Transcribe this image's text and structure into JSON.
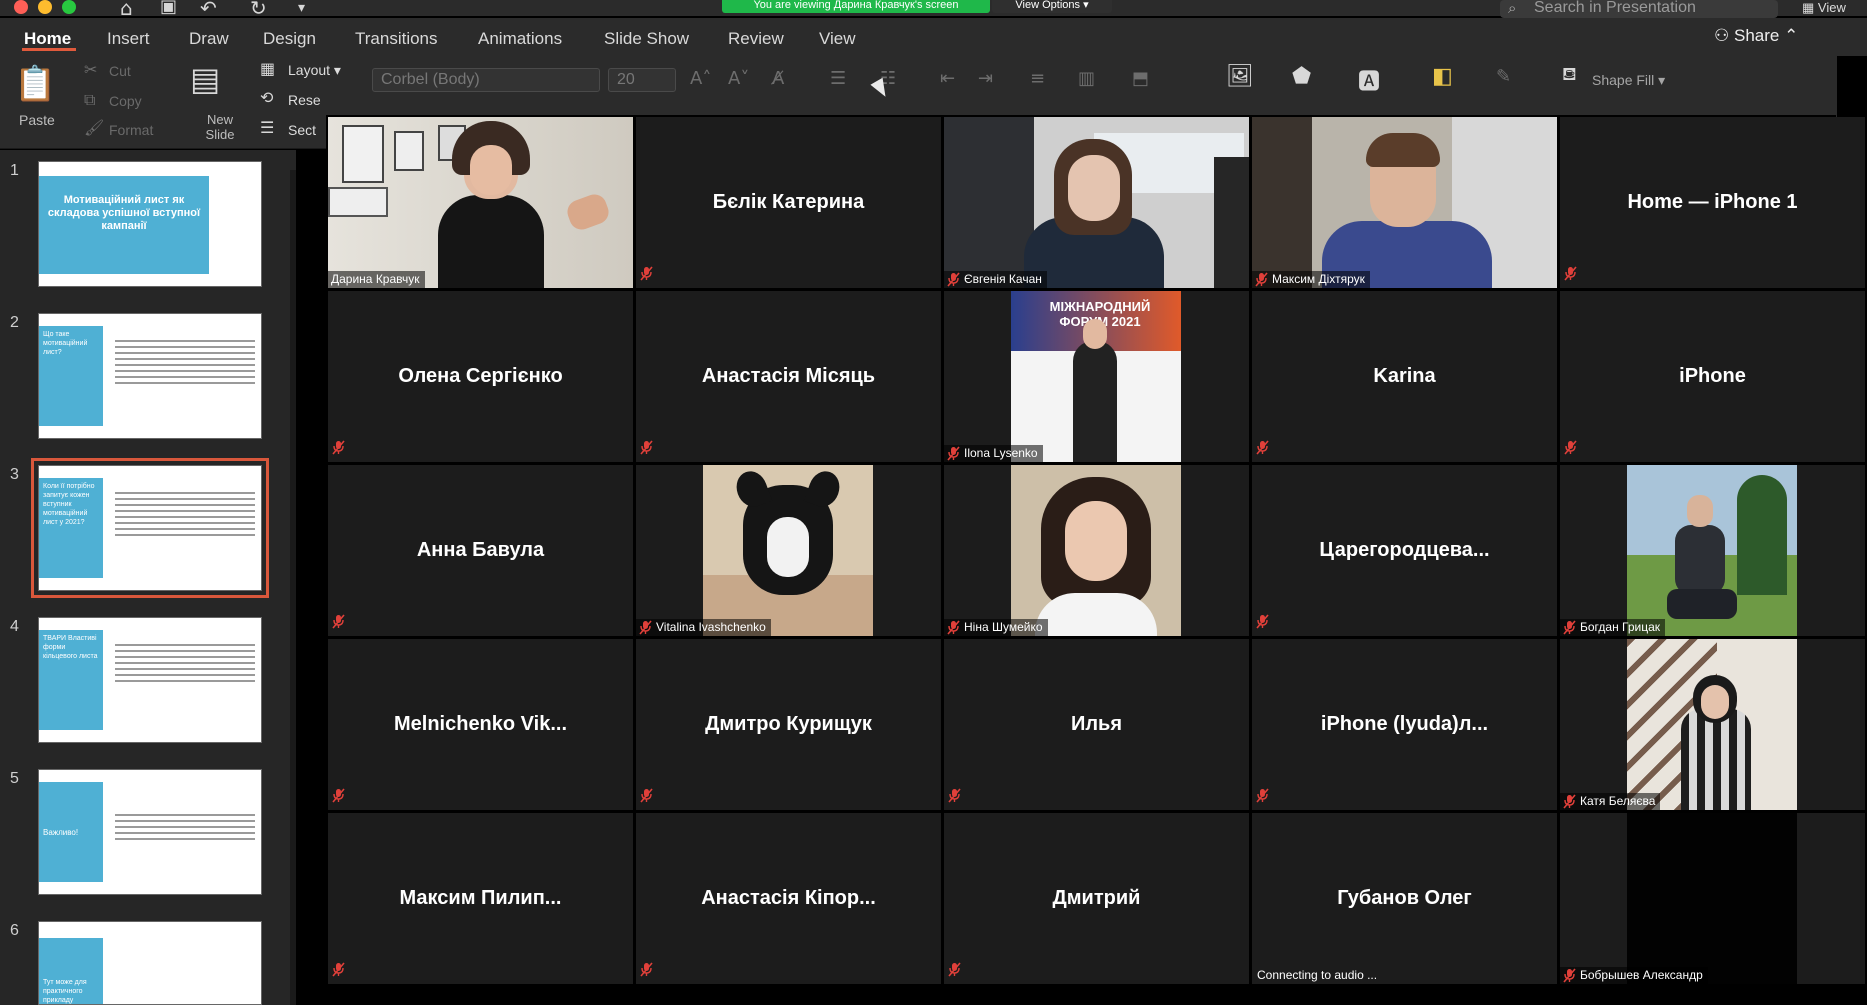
{
  "window": {
    "traffic_colors": [
      "#fe5f57",
      "#febc2e",
      "#28c840"
    ],
    "share_banner": "You are viewing Дарина Кравчук's screen",
    "view_options": "View Options",
    "search_placeholder": "Search in Presentation",
    "view_label": "View"
  },
  "tabs": [
    {
      "label": "Home",
      "active": true
    },
    {
      "label": "Insert"
    },
    {
      "label": "Draw"
    },
    {
      "label": "Design"
    },
    {
      "label": "Transitions"
    },
    {
      "label": "Animations"
    },
    {
      "label": "Slide Show"
    },
    {
      "label": "Review"
    },
    {
      "label": "View"
    }
  ],
  "share_label": "Share",
  "ribbon": {
    "paste": "Paste",
    "cut": "Cut",
    "copy": "Copy",
    "format": "Format",
    "new_slide": "New Slide",
    "layout": "Layout",
    "reset": "Rese",
    "section": "Sect",
    "font_name": "Corbel (Body)",
    "font_size": "20",
    "shape_fill": "Shape Fill"
  },
  "slides": [
    {
      "num": "1",
      "title": "Мотиваційний лист як складова успішної вступної кампанії"
    },
    {
      "num": "2",
      "title": "Що таке мотиваційний лист?"
    },
    {
      "num": "3",
      "title": "Коли її потрібно запитує кожен вступник мотиваційний лист у 2021?",
      "selected": true
    },
    {
      "num": "4",
      "title": "ТВАРИ Властиві форми кільцевого листа"
    },
    {
      "num": "5",
      "title": "Важливо!"
    },
    {
      "num": "6",
      "title": "Тут може для практичного прикладу"
    }
  ],
  "participants": [
    {
      "name": "Дарина Кравчук",
      "video": "speaker"
    },
    {
      "name": "Бєлік Катерина",
      "video": "none"
    },
    {
      "name": "Євгенія Качан",
      "video": "woman-office"
    },
    {
      "name": "Максим Діхтярук",
      "video": "man-office"
    },
    {
      "name": "Home — iPhone 1",
      "video": "none"
    },
    {
      "name": "Олена Сергієнко",
      "video": "none"
    },
    {
      "name": "Анастасія Місяць",
      "video": "none"
    },
    {
      "name": "Ilona Lysenko",
      "video": "forum"
    },
    {
      "name": "Karina",
      "video": "none"
    },
    {
      "name": "iPhone",
      "video": "none"
    },
    {
      "name": "Анна Бавула",
      "video": "none"
    },
    {
      "name": "Vitalina Ivashchenko",
      "video": "dog"
    },
    {
      "name": "Ніна Шумейко",
      "video": "portrait"
    },
    {
      "name": "Царегородцева...",
      "video": "none"
    },
    {
      "name": "Богдан Грицак",
      "video": "outdoor"
    },
    {
      "name": "Melnichenko  Vik...",
      "video": "none"
    },
    {
      "name": "Дмитро Курищук",
      "video": "none"
    },
    {
      "name": "Илья",
      "video": "none"
    },
    {
      "name": "iPhone  (lyuda)л...",
      "video": "none"
    },
    {
      "name": "Катя Беляєва",
      "video": "stairs"
    },
    {
      "name": "Максим  Пилип...",
      "video": "none"
    },
    {
      "name": "Анастасія Кіпор...",
      "video": "none"
    },
    {
      "name": "Дмитрий",
      "video": "none"
    },
    {
      "name": "Губанов Олег",
      "video": "none",
      "status": "Connecting to audio ..."
    },
    {
      "name": "Бобрышев Александр",
      "video": "black"
    }
  ],
  "forum_text": "МІЖНАРОДНИЙ ФОРУМ 2021",
  "accent_colors": {
    "speaker_border": "#c7d84a",
    "muted_mic": "#e0403a",
    "ppt_accent": "#d9573b"
  }
}
